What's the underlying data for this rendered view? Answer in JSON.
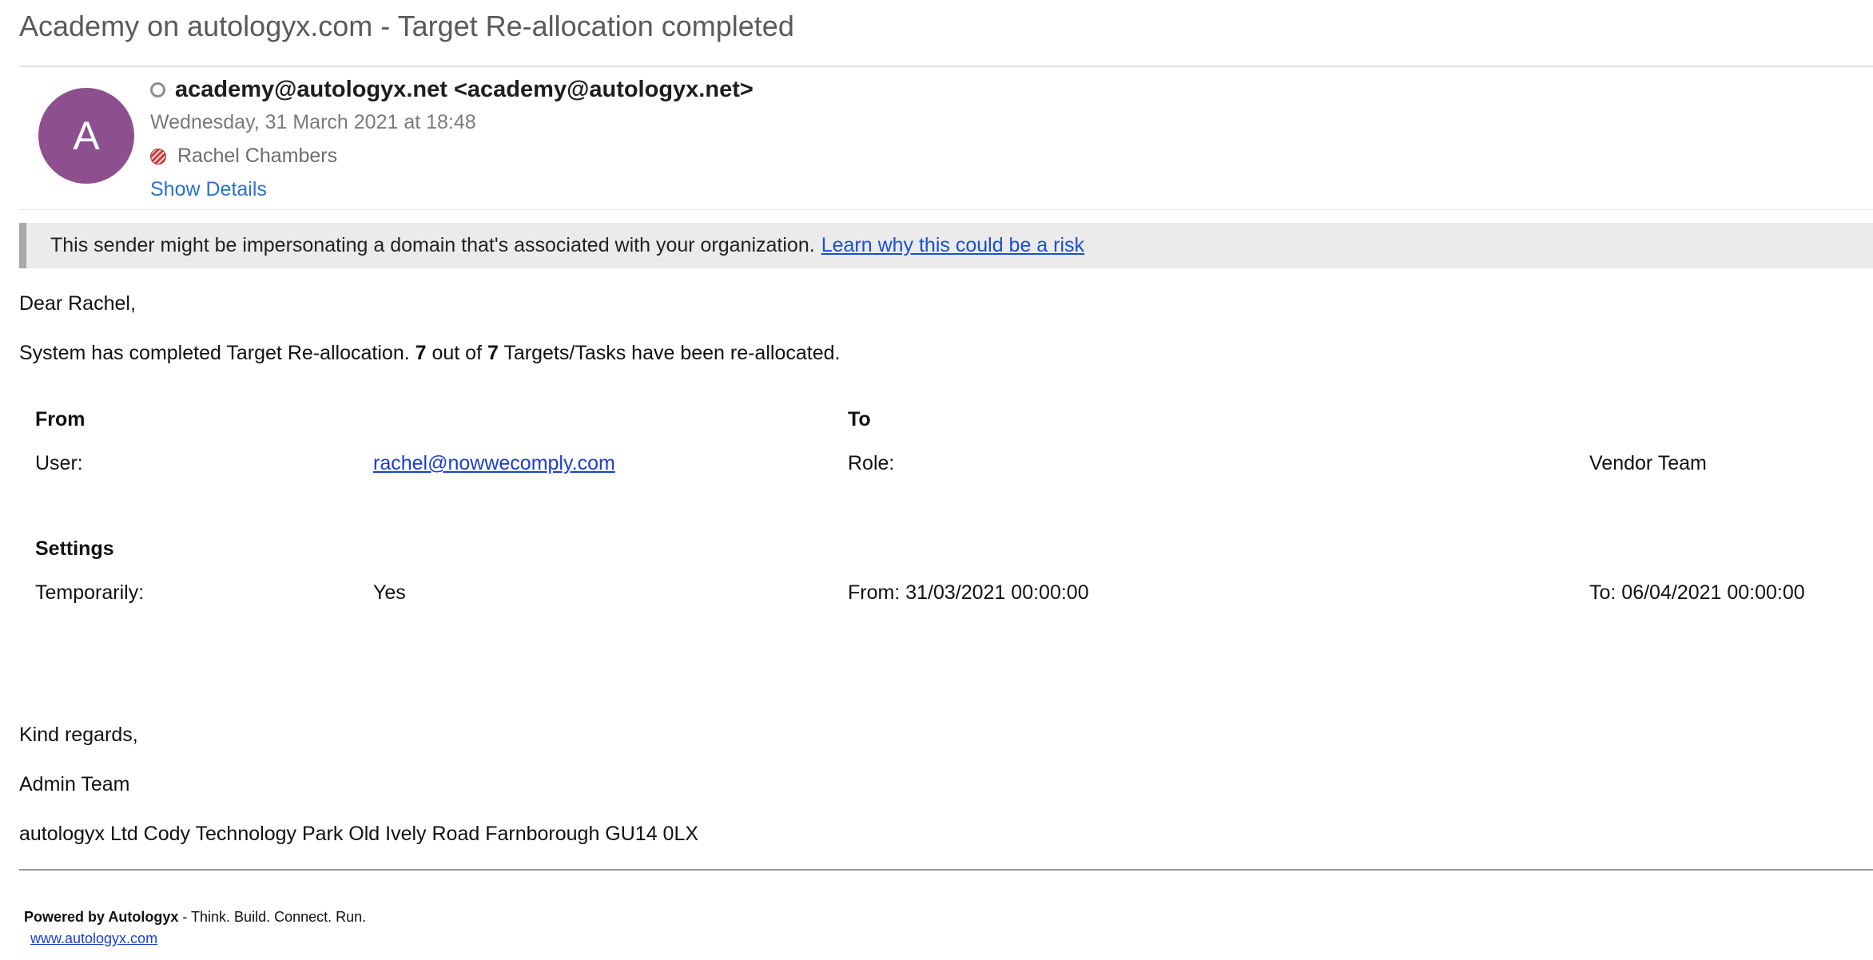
{
  "email": {
    "subject": "Academy on autologyx.com - Target Re-allocation completed",
    "avatar_letter": "A",
    "sender": "academy@autologyx.net <academy@autologyx.net>",
    "date": "Wednesday, 31 March 2021 at 18:48",
    "recipient": "Rachel Chambers",
    "show_details": "Show Details"
  },
  "banner": {
    "text": "This sender might be impersonating a domain that's associated with your organization.",
    "link": "Learn why this could be a risk"
  },
  "body": {
    "greeting": "Dear Rachel,",
    "summary_pre": "System has completed Target Re-allocation. ",
    "summary_count": "7",
    "summary_mid": " out of ",
    "summary_total": "7",
    "summary_post": " Targets/Tasks have been re-allocated.",
    "from_header": "From",
    "to_header": "To",
    "user_label": "User:",
    "user_value": "rachel@nowwecomply.com",
    "role_label": "Role:",
    "role_value": "Vendor Team",
    "settings_header": "Settings",
    "temporarily_label": "Temporarily:",
    "temporarily_value": "Yes",
    "from_date": "From: 31/03/2021 00:00:00",
    "to_date": "To: 06/04/2021 00:00:00",
    "regards": "Kind regards,",
    "team": "Admin Team",
    "address": "autologyx Ltd Cody Technology Park Old Ively Road Farnborough GU14 0LX"
  },
  "footer": {
    "powered_by": "Powered by Autologyx",
    "tagline": " - Think. Build. Connect. Run.",
    "url": "www.autologyx.com"
  },
  "colors": {
    "avatar": "#8e4f8e",
    "link": "#2a72c8",
    "banner_bg": "#ebebeb"
  }
}
